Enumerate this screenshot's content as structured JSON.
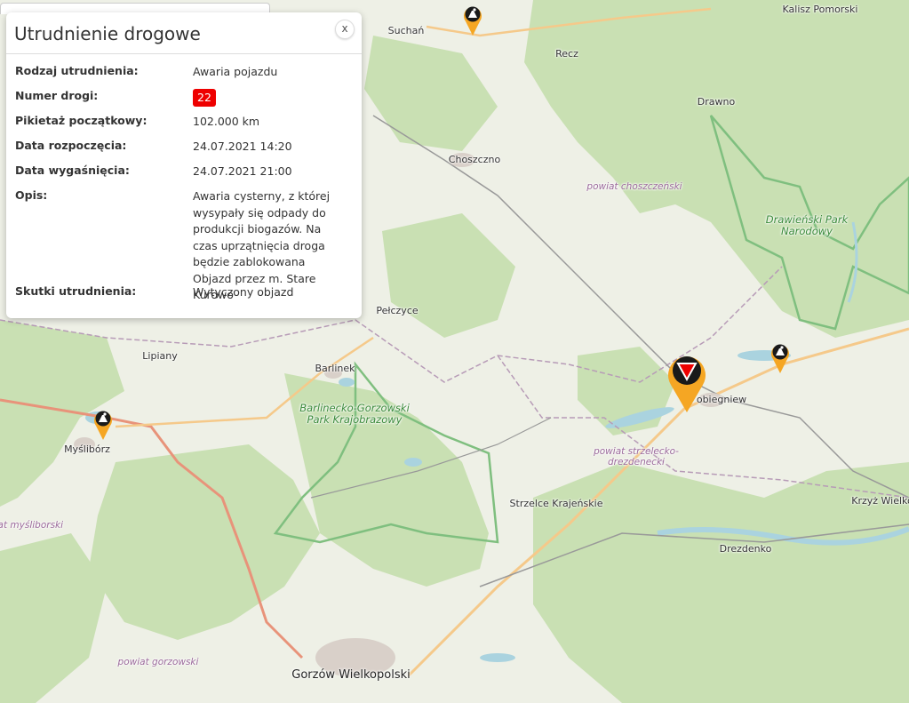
{
  "map": {
    "places": [
      {
        "id": "kalisz",
        "name": "Kalisz Pomorski"
      },
      {
        "id": "suchan",
        "name": "Suchań"
      },
      {
        "id": "recz",
        "name": "Recz"
      },
      {
        "id": "drawno",
        "name": "Drawno"
      },
      {
        "id": "choszczno",
        "name": "Choszczno"
      },
      {
        "id": "pelczyce",
        "name": "Pełczyce"
      },
      {
        "id": "lipiany",
        "name": "Lipiany"
      },
      {
        "id": "barlinek",
        "name": "Barlinek"
      },
      {
        "id": "dobiegniew",
        "name": "obiegniew"
      },
      {
        "id": "mysliborz",
        "name": "Myślibórz"
      },
      {
        "id": "strzelce",
        "name": "Strzelce Krajeńskie"
      },
      {
        "id": "drezdenko",
        "name": "Drezdenko"
      },
      {
        "id": "krzyz",
        "name": "Krzyż Wielko"
      },
      {
        "id": "gorzow",
        "name": "Gorzów Wielkopolski"
      }
    ],
    "areas": [
      {
        "id": "drawienski",
        "name": "Drawieński Park Narodowy"
      },
      {
        "id": "barlinecko",
        "name": "Barlinecko-Gorzowski Park Krajobrazowy"
      }
    ],
    "districts": [
      {
        "id": "choszczenski",
        "name": "powiat choszczeński"
      },
      {
        "id": "strzelecko",
        "name": "powiat strzelecko-drezdenecki"
      },
      {
        "id": "mysliborski",
        "name": "powiat myśliborski"
      },
      {
        "id": "gorzowski",
        "name": "powiat gorzowski"
      }
    ],
    "colors": {
      "land": "#eef0e6",
      "forest": "#c9e0b3",
      "water": "#aad3df",
      "major_road": "#e8937a",
      "road": "#f5c98a",
      "pin": "#f5a623",
      "marker_black": "#1a1a1a"
    }
  },
  "popup": {
    "title": "Utrudnienie drogowe",
    "close_label": "x",
    "rows": [
      {
        "label": "Rodzaj utrudnienia:",
        "value": "Awaria pojazdu"
      },
      {
        "label": "Numer drogi:",
        "value": "22",
        "badge": true
      },
      {
        "label": "Pikietaż początkowy:",
        "value": "102.000 km"
      },
      {
        "label": "Data rozpoczęcia:",
        "value": "24.07.2021 14:20"
      },
      {
        "label": "Data wygaśnięcia:",
        "value": "24.07.2021 21:00"
      },
      {
        "label": "Opis:",
        "value": "Awaria cysterny, z której wysypały się odpady do produkcji biogazów. Na czas uprzątnięcia droga będzie zablokowana Objazd przez m. Stare Kurowo"
      },
      {
        "label": "Skutki utrudnienia:",
        "value": "Wytyczony objazd"
      }
    ],
    "badge_color": "#e00000"
  },
  "markers": [
    {
      "id": "roadwork-suchan",
      "icon": "roadworks-pin-icon"
    },
    {
      "id": "roadwork-dobiegniew",
      "icon": "roadworks-pin-icon"
    },
    {
      "id": "roadwork-mysliborz",
      "icon": "roadworks-pin-icon"
    },
    {
      "id": "incident",
      "icon": "warning-triangle-pin-icon"
    }
  ]
}
